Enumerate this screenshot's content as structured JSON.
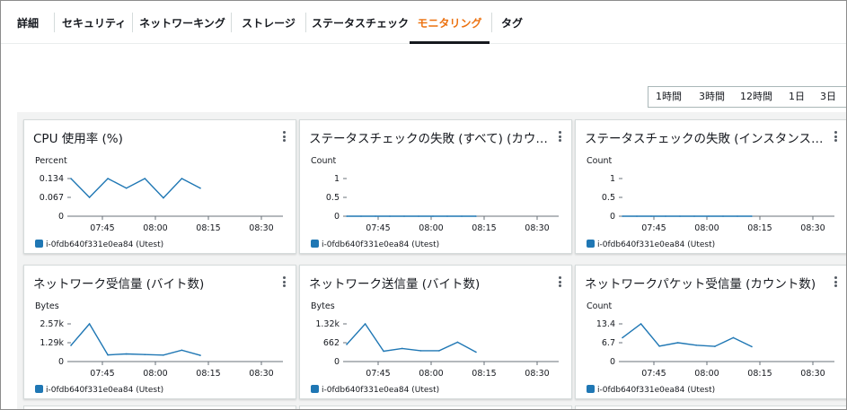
{
  "tabs": [
    "詳細",
    "セキュリティ",
    "ネットワーキング",
    "ストレージ",
    "ステータスチェック",
    "モニタリング",
    "タグ"
  ],
  "active_tab": "モニタリング",
  "time_ranges": [
    "1時間",
    "3時間",
    "12時間",
    "1日",
    "3日"
  ],
  "colors": {
    "accent": "#ec7211",
    "series": "#1f77b4"
  },
  "legend_label": "i-0fdb640f331e0ea84 (Utest)",
  "menu_icon": "vertical-ellipsis-icon",
  "widgets": [
    {
      "title": "CPU 使用率 (%)",
      "unit": "Percent"
    },
    {
      "title": "ステータスチェックの失敗 (すべて) (カウント数)",
      "unit": "Count"
    },
    {
      "title": "ステータスチェックの失敗 (インスタンス) (カウント数)",
      "unit": "Count"
    },
    {
      "title": "ネットワーク受信量 (バイト数)",
      "unit": "Bytes"
    },
    {
      "title": "ネットワーク送信量 (バイト数)",
      "unit": "Bytes"
    },
    {
      "title": "ネットワークパケット受信量 (カウント数)",
      "unit": "Count"
    }
  ],
  "chart_data": [
    {
      "type": "line",
      "x_ticks": [
        "07:45",
        "08:00",
        "08:15",
        "08:30"
      ],
      "y_ticks": [
        "0.134",
        "0.067",
        "0"
      ],
      "ylim": [
        0,
        0.134
      ],
      "series": [
        {
          "values": [
            0.134,
            0.067,
            0.134,
            0.1,
            0.134,
            0.065,
            0.134,
            0.1
          ]
        }
      ]
    },
    {
      "type": "line",
      "x_ticks": [
        "07:45",
        "08:00",
        "08:15",
        "08:30"
      ],
      "y_ticks": [
        "1",
        "0.5",
        "0"
      ],
      "ylim": [
        0,
        1
      ],
      "series": [
        {
          "values": [
            0,
            0,
            0,
            0,
            0,
            0,
            0,
            0,
            0,
            0
          ]
        }
      ]
    },
    {
      "type": "line",
      "x_ticks": [
        "07:45",
        "08:00",
        "08:15",
        "08:30"
      ],
      "y_ticks": [
        "1",
        "0.5",
        "0"
      ],
      "ylim": [
        0,
        1
      ],
      "series": [
        {
          "values": [
            0,
            0,
            0,
            0,
            0,
            0,
            0,
            0,
            0,
            0
          ]
        }
      ]
    },
    {
      "type": "line",
      "x_ticks": [
        "07:45",
        "08:00",
        "08:15",
        "08:30"
      ],
      "y_ticks": [
        "2.57k",
        "1.29k",
        "0"
      ],
      "ylim": [
        0,
        2570
      ],
      "series": [
        {
          "values": [
            1100,
            2570,
            450,
            520,
            480,
            440,
            780,
            420
          ]
        }
      ]
    },
    {
      "type": "line",
      "x_ticks": [
        "07:45",
        "08:00",
        "08:15",
        "08:30"
      ],
      "y_ticks": [
        "1.32k",
        "662",
        "0"
      ],
      "ylim": [
        0,
        1320
      ],
      "series": [
        {
          "values": [
            600,
            1320,
            360,
            460,
            380,
            380,
            680,
            330
          ]
        }
      ]
    },
    {
      "type": "line",
      "x_ticks": [
        "07:45",
        "08:00",
        "08:15",
        "08:30"
      ],
      "y_ticks": [
        "13.4",
        "6.7",
        "0"
      ],
      "ylim": [
        0,
        13.4
      ],
      "series": [
        {
          "values": [
            8.5,
            13.4,
            5.5,
            6.7,
            5.8,
            5.4,
            8.5,
            5.3
          ]
        }
      ]
    }
  ]
}
